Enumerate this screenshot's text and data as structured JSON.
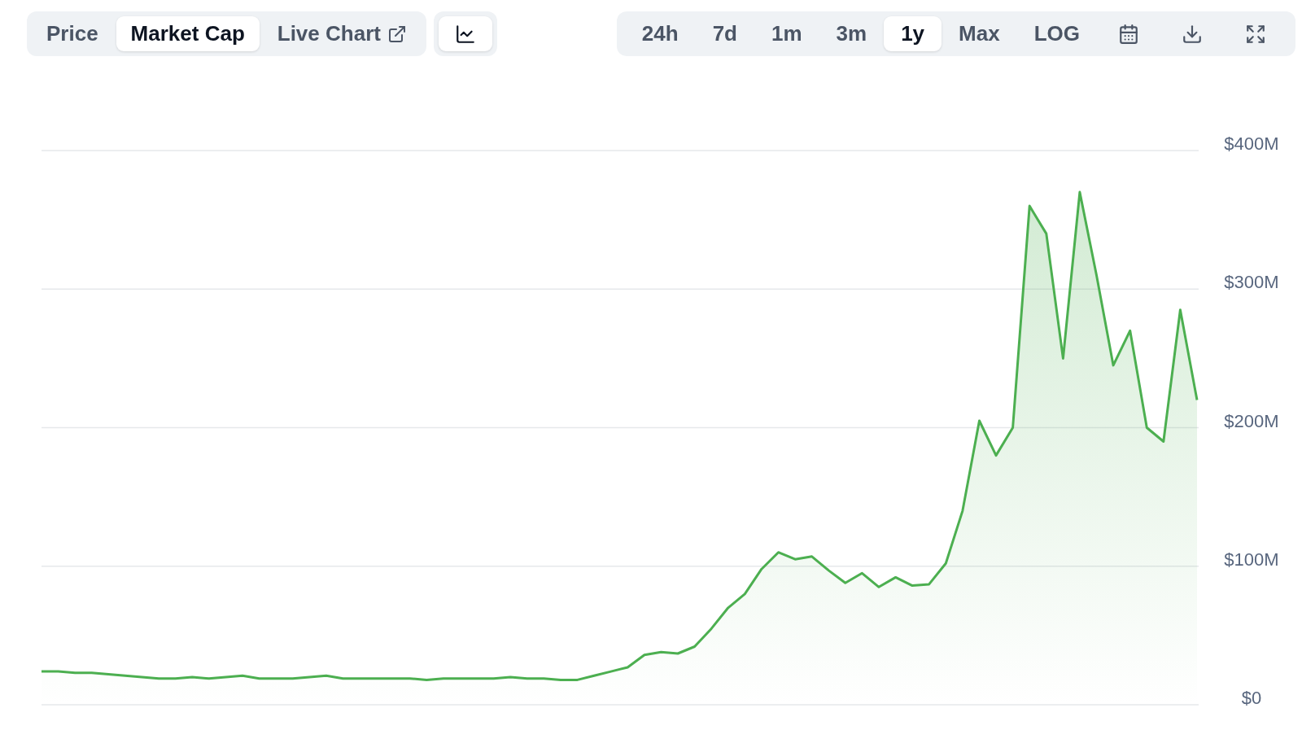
{
  "view_tabs": [
    {
      "label": "Price",
      "selected": false,
      "kind": "text"
    },
    {
      "label": "Market Cap",
      "selected": true,
      "kind": "text"
    },
    {
      "label": "Live Chart",
      "selected": false,
      "kind": "external"
    }
  ],
  "chart_style": {
    "selected": true
  },
  "ranges": [
    {
      "label": "24h",
      "selected": false
    },
    {
      "label": "7d",
      "selected": false
    },
    {
      "label": "1m",
      "selected": false
    },
    {
      "label": "3m",
      "selected": false
    },
    {
      "label": "1y",
      "selected": true
    },
    {
      "label": "Max",
      "selected": false
    },
    {
      "label": "LOG",
      "selected": false
    }
  ],
  "tools": [
    {
      "kind": "calendar"
    },
    {
      "kind": "download"
    },
    {
      "kind": "expand"
    }
  ],
  "chart_data": {
    "type": "area",
    "grid": true,
    "ylim": [
      0,
      400
    ],
    "yticks": [
      {
        "value": 0,
        "label": "$0"
      },
      {
        "value": 100,
        "label": "$100M"
      },
      {
        "value": 200,
        "label": "$200M"
      },
      {
        "value": 300,
        "label": "$300M"
      },
      {
        "value": 400,
        "label": "$400M"
      }
    ],
    "series": [
      {
        "color": "#4caf50",
        "values": [
          24,
          24,
          23,
          23,
          22,
          21,
          20,
          19,
          19,
          20,
          19,
          20,
          21,
          19,
          19,
          19,
          20,
          21,
          19,
          19,
          19,
          19,
          19,
          18,
          19,
          19,
          19,
          19,
          20,
          19,
          19,
          18,
          18,
          21,
          24,
          27,
          36,
          38,
          37,
          42,
          55,
          70,
          80,
          98,
          110,
          105,
          107,
          97,
          88,
          95,
          85,
          92,
          86,
          87,
          102,
          140,
          205,
          180,
          200,
          360,
          340,
          250,
          370,
          310,
          245,
          270,
          200,
          190,
          285,
          220
        ]
      }
    ]
  }
}
